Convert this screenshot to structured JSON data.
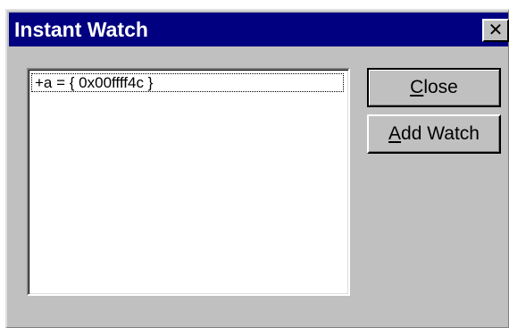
{
  "window": {
    "title": "Instant Watch",
    "close_glyph": "✕",
    "close_icon": "close-icon"
  },
  "watch_list": {
    "items": [
      {
        "label": "+a = { 0x00ffff4c }"
      }
    ]
  },
  "buttons": {
    "close": {
      "accel": "C",
      "rest": "lose"
    },
    "add_watch": {
      "accel": "A",
      "rest": "dd Watch"
    }
  },
  "colors": {
    "titlebar": "#000080",
    "dialog_face": "#c0c0c0",
    "list_bg": "#ffffff"
  }
}
